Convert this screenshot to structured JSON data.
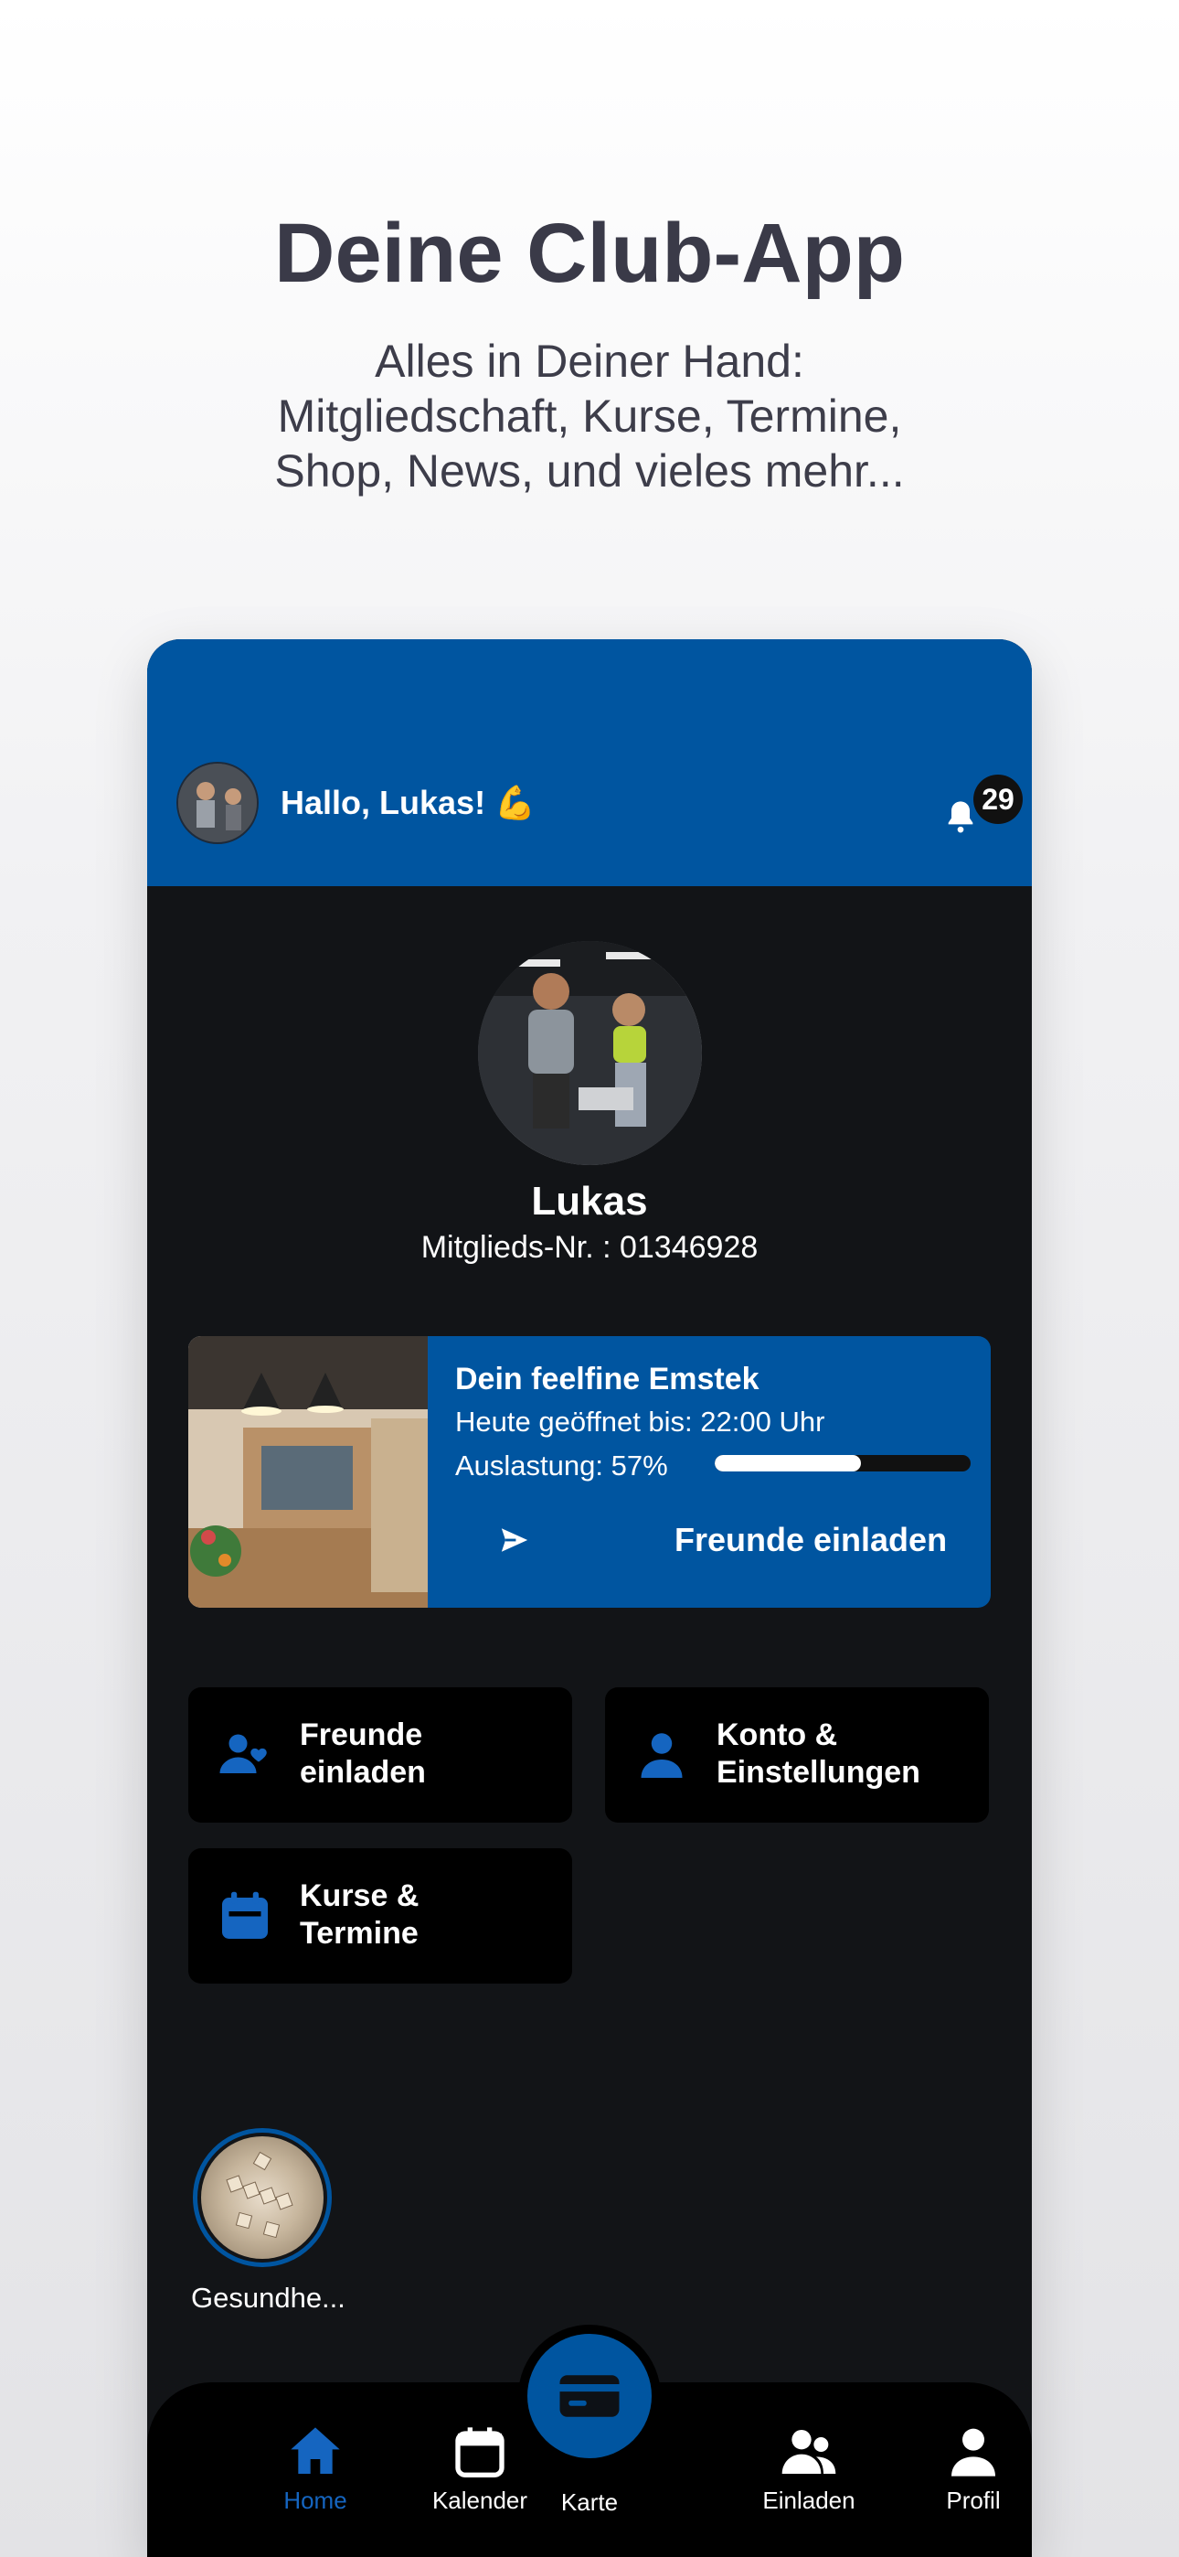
{
  "promo": {
    "title": "Deine Club-App",
    "subtitle_lines": [
      "Alles in Deiner Hand:",
      "Mitgliedschaft, Kurse, Termine,",
      "Shop, News, und vieles mehr..."
    ]
  },
  "header": {
    "greeting": "Hallo, Lukas! 💪",
    "notification_count": "29"
  },
  "profile": {
    "name": "Lukas",
    "member_number": "Mitglieds-Nr. : 01346928"
  },
  "club_card": {
    "title": "Dein feelfine Emstek",
    "hours": "Heute geöffnet bis: 22:00 Uhr",
    "load_label": "Auslastung: 57%",
    "load_fraction": 0.57,
    "invite_label": "Freunde einladen"
  },
  "tiles": [
    {
      "icon": "user-heart-icon",
      "lines": [
        "Freunde",
        "einladen"
      ]
    },
    {
      "icon": "person-icon",
      "lines": [
        "Konto &",
        "Einstellungen"
      ]
    },
    {
      "icon": "calendar-icon",
      "lines": [
        "Kurse &",
        "Termine"
      ]
    }
  ],
  "story": {
    "label": "Gesundhe..."
  },
  "tabbar": {
    "items": [
      {
        "label": "Home",
        "icon": "home-icon",
        "active": true
      },
      {
        "label": "Kalender",
        "icon": "calendar-icon",
        "active": false
      },
      {
        "label": "Karte",
        "icon": "card-icon",
        "active": false
      },
      {
        "label": "Einladen",
        "icon": "group-icon",
        "active": false
      },
      {
        "label": "Profil",
        "icon": "person-icon",
        "active": false
      }
    ]
  },
  "colors": {
    "brand_blue": "#0055a0",
    "active_tab": "#1565c0",
    "app_background": "#121417"
  }
}
